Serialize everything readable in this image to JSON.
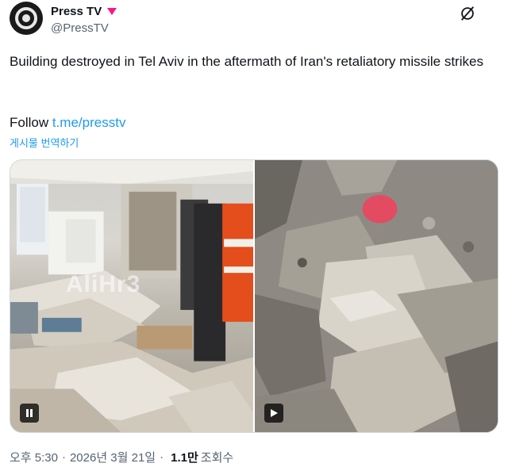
{
  "author": {
    "display_name": "Press TV",
    "handle": "@PressTV"
  },
  "tweet": {
    "text": "Building destroyed in Tel Aviv in the aftermath of Iran's retaliatory missile strikes",
    "follow_prefix": "Follow ",
    "follow_link": "t.me/presstv",
    "translate_label": "게시물 번역하기"
  },
  "media": {
    "watermark": "AliHr3"
  },
  "meta": {
    "time": "오후 5:30",
    "separator1": "·",
    "date": "2026년 3월 21일",
    "separator2": "·",
    "views_count": "1.1만",
    "views_label": "조회수"
  },
  "colors": {
    "accent": "#1d9bf0",
    "muted": "#536471",
    "text": "#0f1419",
    "badge": "#f91880"
  },
  "icons": {
    "badge": "heart-badge-icon",
    "grok": "grok-icon",
    "pause": "pause-icon",
    "play": "play-icon"
  }
}
